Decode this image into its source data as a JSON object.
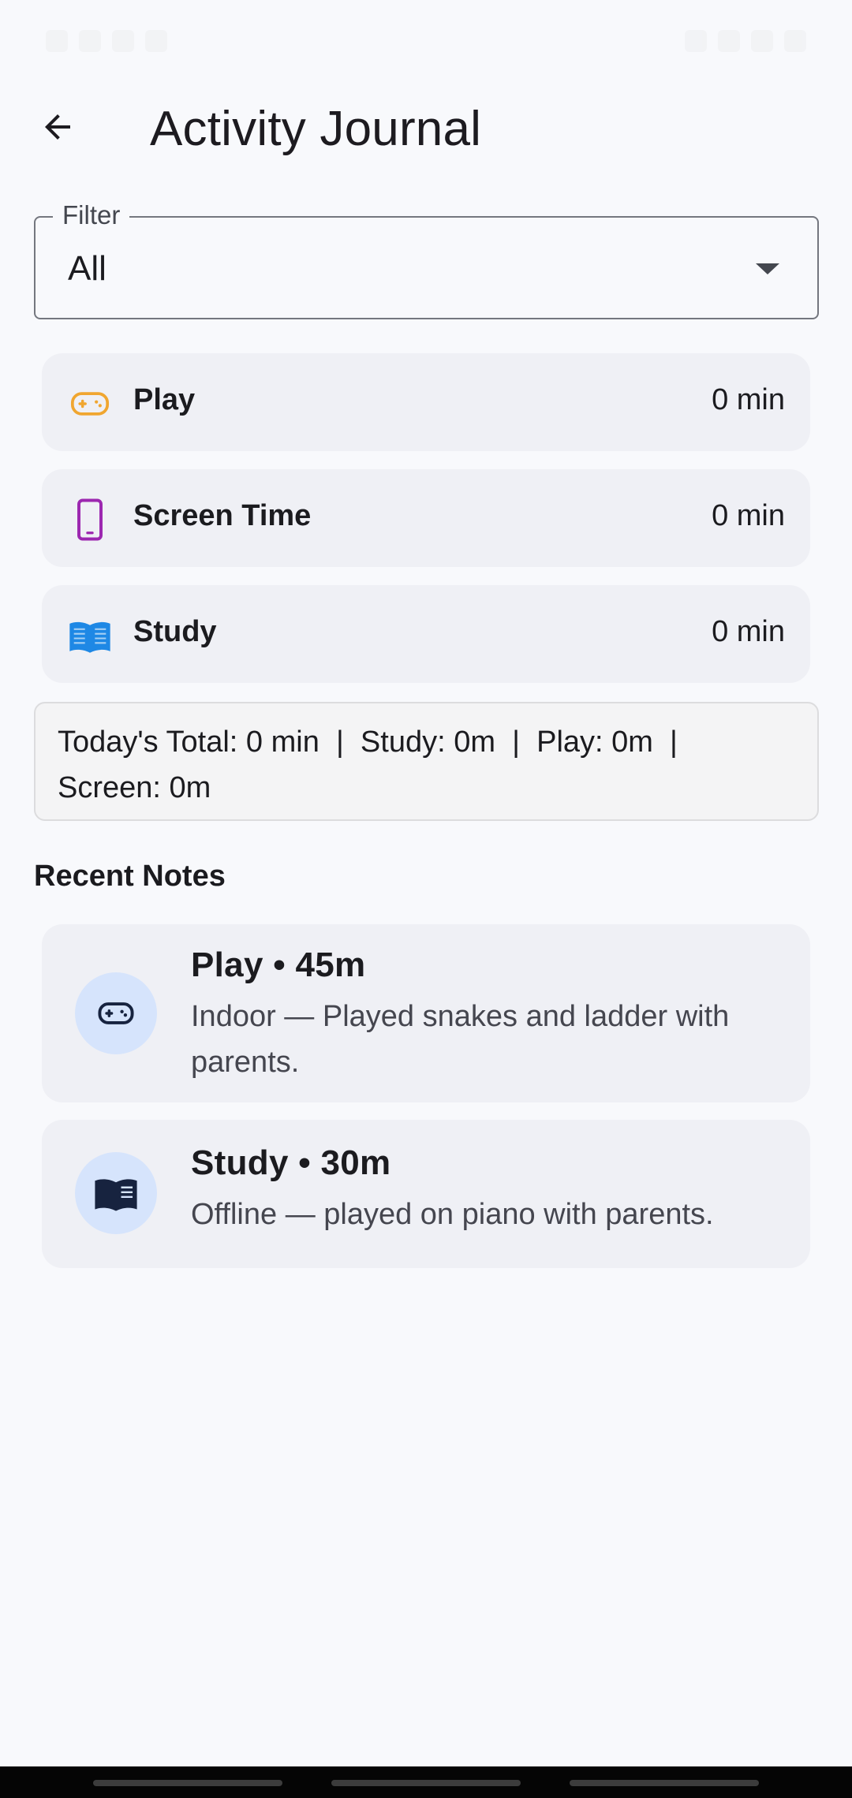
{
  "header": {
    "title": "Activity Journal"
  },
  "filter": {
    "label": "Filter",
    "value": "All"
  },
  "categories": [
    {
      "name": "Play",
      "value": "0 min",
      "icon": "gamepad-icon",
      "color": "#f0a630"
    },
    {
      "name": "Screen Time",
      "value": "0 min",
      "icon": "phone-icon",
      "color": "#9c27b0"
    },
    {
      "name": "Study",
      "value": "0 min",
      "icon": "book-icon",
      "color": "#1e88e5"
    }
  ],
  "summary": {
    "line1": "Today's Total: 0 min  |  Study: 0m  |  Play: 0m  |",
    "line2": "Screen: 0m"
  },
  "recent": {
    "title": "Recent Notes",
    "notes": [
      {
        "title": "Play • 45m",
        "body": "Indoor — Played snakes and ladder with parents.",
        "icon": "gamepad-icon"
      },
      {
        "title": "Study • 30m",
        "body": "Offline — played on piano with parents.",
        "icon": "book-icon"
      }
    ]
  },
  "colors": {
    "background": "#f8f9fc",
    "card": "#eff0f5",
    "avatar": "#d6e4fc",
    "navy_icon": "#17233f"
  }
}
